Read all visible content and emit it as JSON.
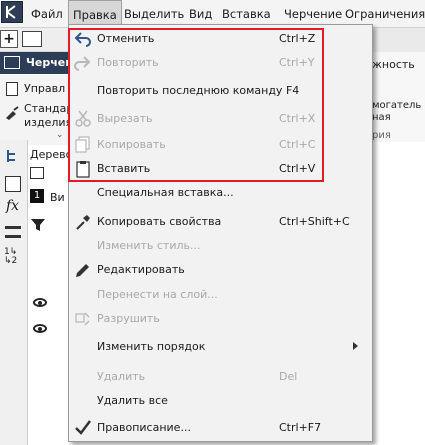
{
  "menubar": {
    "items": [
      {
        "label": "Файл"
      },
      {
        "label": "Правка"
      },
      {
        "label": "Выделить"
      },
      {
        "label": "Вид"
      },
      {
        "label": "Вставка"
      },
      {
        "label": "Черчение"
      },
      {
        "label": "Ограничения"
      }
    ]
  },
  "background": {
    "doc_tab": "Черчен",
    "toolbar_label_1": "Управл",
    "toolbar_label_2a": "Стандар",
    "toolbar_label_2b": "изделия",
    "tree_label": "Дерево",
    "tree_tab": "1",
    "tree_tab_suffix": "Ви",
    "right_label_1": "жность",
    "right_label_2a": "могатель",
    "right_label_2b": "ная",
    "right_label_3": "рия"
  },
  "dropdown": {
    "items": [
      {
        "label": "Отменить",
        "shortcut": "Ctrl+Z",
        "icon": "undo-icon"
      },
      {
        "label": "Повторить",
        "shortcut": "Ctrl+Y",
        "icon": "redo-icon"
      },
      {
        "label": "Повторить последнюю команду F4",
        "shortcut": ""
      },
      {
        "label": "Вырезать",
        "shortcut": "Ctrl+X",
        "icon": "scissors-icon"
      },
      {
        "label": "Копировать",
        "shortcut": "Ctrl+C",
        "icon": "copy-icon"
      },
      {
        "label": "Вставить",
        "shortcut": "Ctrl+V",
        "icon": "paste-icon"
      },
      {
        "label": "Специальная вставка...",
        "shortcut": ""
      },
      {
        "label": "Копировать свойства",
        "shortcut": "Ctrl+Shift+C",
        "icon": "eyedropper-icon"
      },
      {
        "label": "Изменить стиль...",
        "shortcut": ""
      },
      {
        "label": "Редактировать",
        "shortcut": "",
        "icon": "pencil-icon"
      },
      {
        "label": "Перенести на слой...",
        "shortcut": ""
      },
      {
        "label": "Разрушить",
        "shortcut": "",
        "icon": "destroy-icon"
      },
      {
        "label": "Изменить порядок",
        "shortcut": ""
      },
      {
        "label": "Удалить",
        "shortcut": "Del"
      },
      {
        "label": "Удалить все",
        "shortcut": ""
      },
      {
        "label": "Правописание...",
        "shortcut": "Ctrl+F7",
        "icon": "checkmark-icon"
      }
    ]
  },
  "colors": {
    "highlight": "#e21b2b",
    "disabled_text": "#a8a8a8",
    "doc_tab_bg": "#2c3e57"
  }
}
